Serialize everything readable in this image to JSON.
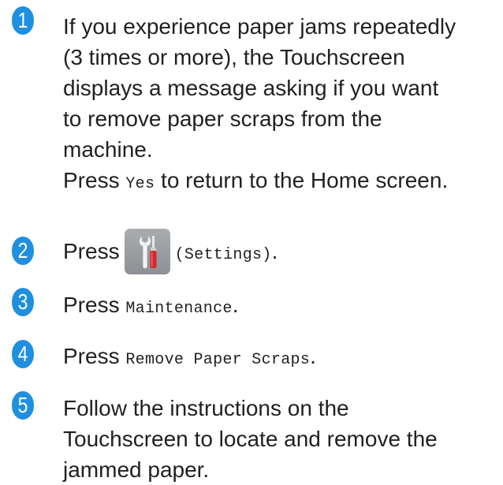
{
  "steps": [
    {
      "number": "1",
      "lines": [
        "If you experience paper jams repeatedly",
        "(3 times or more), the Touchscreen",
        "displays a message asking if you want",
        "to remove paper scraps from the",
        "machine."
      ],
      "press_prefix": "Press",
      "button": "Yes",
      "suffix": "to return to the Home screen."
    },
    {
      "number": "2",
      "press_prefix": "Press",
      "button": "(Settings)",
      "suffix": ".",
      "icon": "settings-tools-icon"
    },
    {
      "number": "3",
      "press_prefix": "Press",
      "button": "Maintenance",
      "suffix": "."
    },
    {
      "number": "4",
      "press_prefix": "Press",
      "button": "Remove Paper Scraps",
      "suffix": "."
    },
    {
      "number": "5",
      "lines": [
        "Follow the instructions on the",
        "Touchscreen to locate and remove the",
        "jammed paper."
      ]
    }
  ],
  "colors": {
    "badge": "#1f8fe0",
    "text": "#231f20",
    "icon_bg": "#999c9f"
  }
}
